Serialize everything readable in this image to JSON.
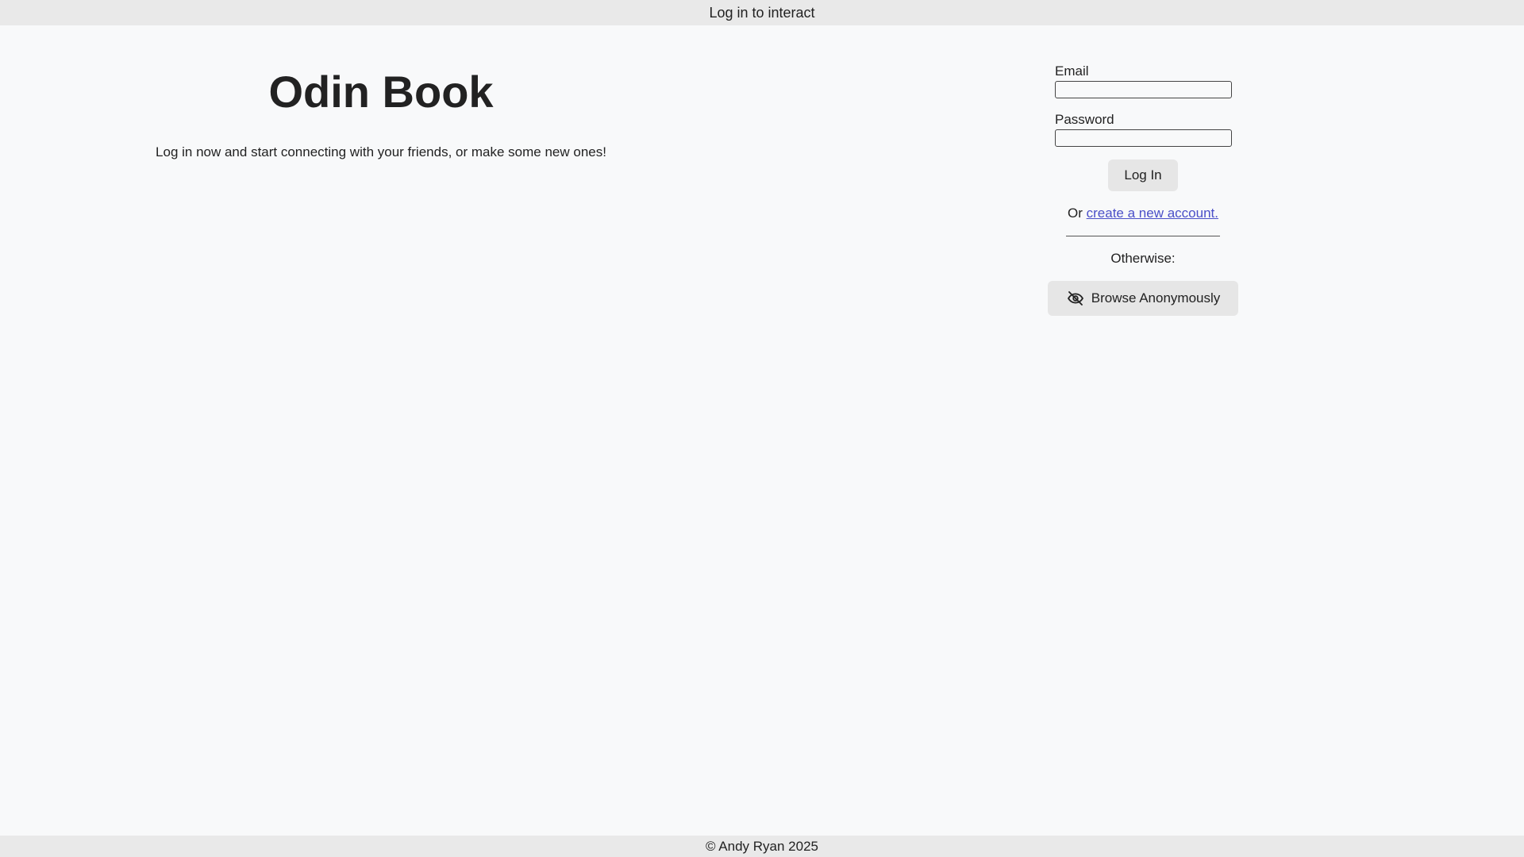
{
  "topbar": {
    "text": "Log in to interact"
  },
  "hero": {
    "title": "Odin Book",
    "subtitle": "Log in now and start connecting with your friends, or make some new ones!"
  },
  "login": {
    "email_label": "Email",
    "email_value": "",
    "password_label": "Password",
    "password_value": "",
    "login_button": "Log In",
    "or_text": "Or ",
    "create_account_link": "create a new account.",
    "otherwise_text": "Otherwise:",
    "anon_button": "Browse Anonymously",
    "anon_icon": "eye-off-icon"
  },
  "footer": {
    "text": "© Andy Ryan 2025"
  }
}
